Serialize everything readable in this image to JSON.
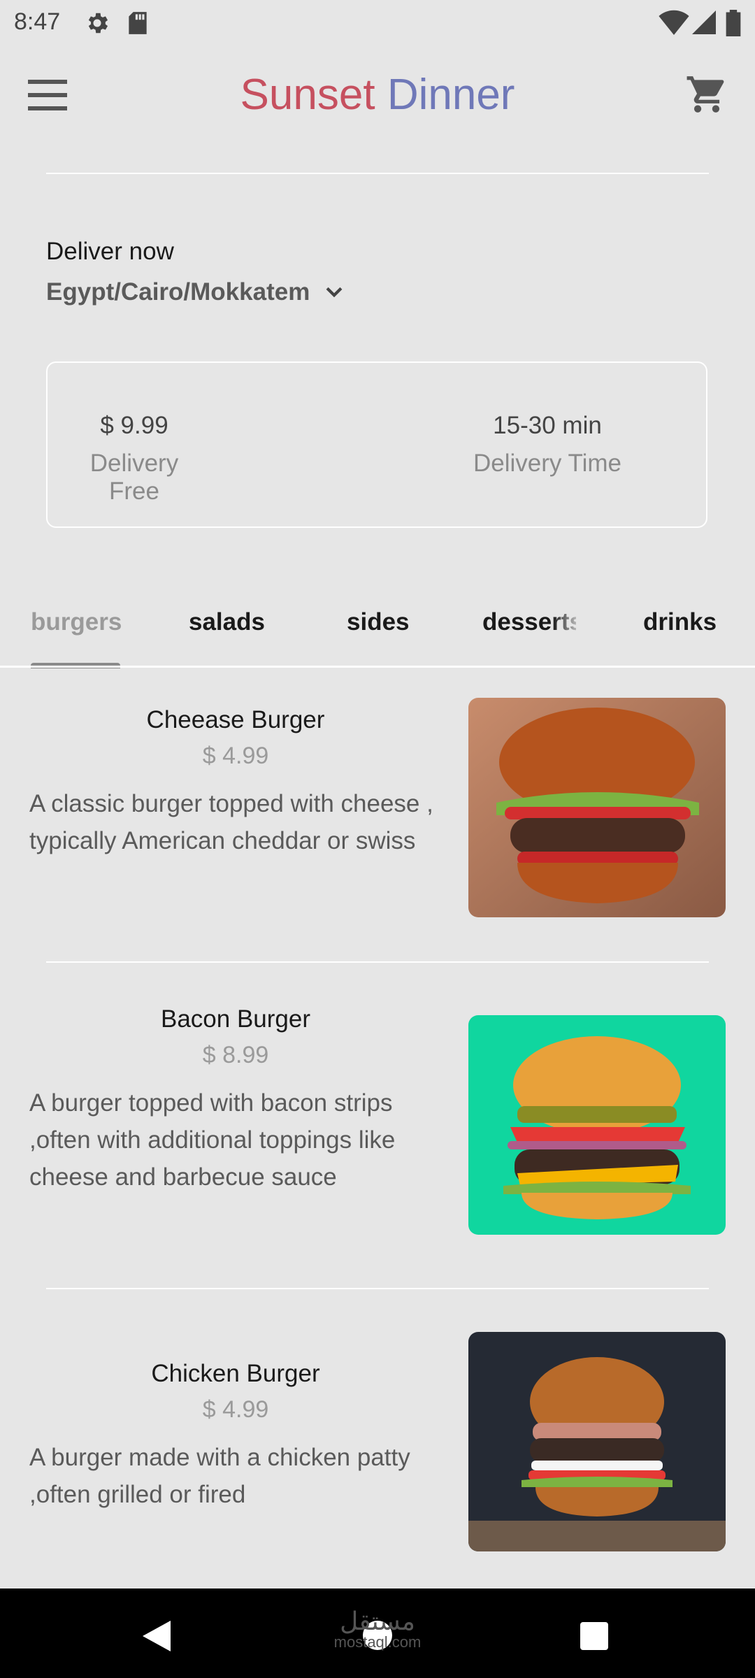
{
  "status_bar": {
    "time": "8:47"
  },
  "app_bar": {
    "title_part1": "Sunset",
    "title_part2": "Dinner"
  },
  "delivery": {
    "label": "Deliver now",
    "location": "Egypt/Cairo/Mokkatem",
    "fee_value": "$ 9.99",
    "fee_label": "Delivery Free",
    "time_value": "15-30 min",
    "time_label": "Delivery Time"
  },
  "tabs": [
    {
      "label": "burgers",
      "active": true
    },
    {
      "label": "salads"
    },
    {
      "label": "sides"
    },
    {
      "label": "desserts"
    },
    {
      "label": "drinks"
    }
  ],
  "items": [
    {
      "name": "Cheease Burger",
      "price": "$ 4.99",
      "description": "A classic burger topped with cheese , typically American cheddar or swiss",
      "image_bg": "#b9765a"
    },
    {
      "name": "Bacon Burger",
      "price": "$ 8.99",
      "description": "A burger topped with bacon strips ,often with additional toppings like cheese and barbecue sauce",
      "image_bg": "#10d69f"
    },
    {
      "name": "Chicken Burger",
      "price": "$ 4.99",
      "description": "A burger made with a chicken patty ,often grilled or fired",
      "image_bg": "#252a34"
    }
  ],
  "watermark": {
    "arabic": "مستقل",
    "latin": "mostaql.com"
  },
  "colors": {
    "title1": "#c6505f",
    "title2": "#6f78b8",
    "background": "#e6e6e6"
  }
}
